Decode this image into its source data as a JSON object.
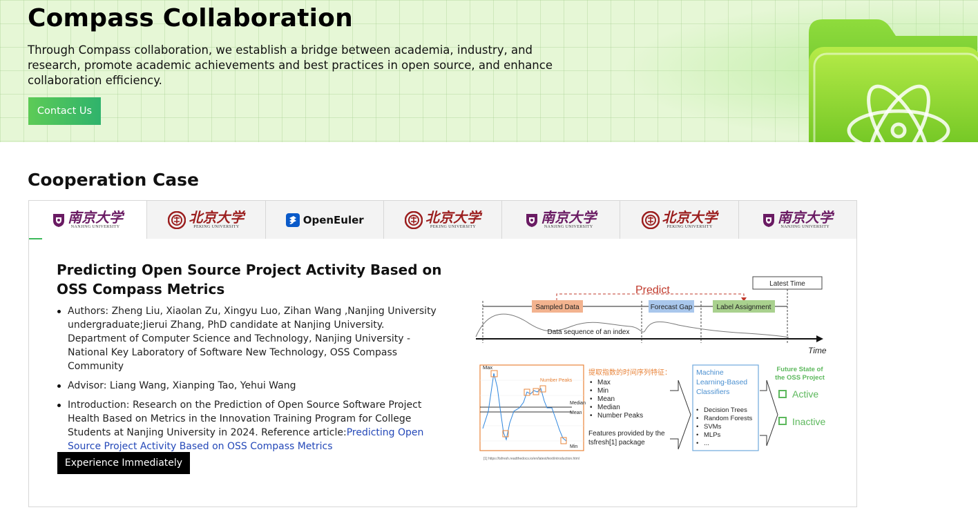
{
  "hero": {
    "title": "Compass Collaboration",
    "description": "Through Compass collaboration, we establish a bridge between academia, industry, and research, promote academic achievements and best practices in open source, and enhance collaboration efficiency.",
    "contact_button": "Contact Us",
    "illustration_icon": "atom-folder-icon"
  },
  "section": {
    "title": "Cooperation Case"
  },
  "tabs": [
    {
      "logo": "nju",
      "cn": "南京大学",
      "en": "NANJING UNIVERSITY",
      "active": true
    },
    {
      "logo": "pku",
      "cn": "北京大学",
      "en": "PEKING UNIVERSITY"
    },
    {
      "logo": "openeuler",
      "name": "OpenEuler"
    },
    {
      "logo": "pku",
      "cn": "北京大学",
      "en": "PEKING UNIVERSITY"
    },
    {
      "logo": "nju",
      "cn": "南京大学",
      "en": "NANJING UNIVERSITY"
    },
    {
      "logo": "pku",
      "cn": "北京大学",
      "en": "PEKING UNIVERSITY"
    },
    {
      "logo": "nju",
      "cn": "南京大学",
      "en": "NANJING UNIVERSITY"
    }
  ],
  "case": {
    "title": "Predicting Open Source Project Activity Based on OSS Compass Metrics",
    "authors": "Authors: Zheng Liu, Xiaolan Zu, Xingyu Luo, Zihan Wang ,Nanjing University undergraduate;Jierui Zhang, PhD candidate at Nanjing University. Department of Computer Science and Technology, Nanjing University - National Key Laboratory of Software New Technology, OSS Compass Community",
    "advisor": "Advisor: Liang Wang, Xianping Tao, Yehui Wang",
    "intro_prefix": "Introduction: Research on the Prediction of Open Source Software Project Health Based on Metrics in the Innovation Training Program for College Students at Nanjing University in 2024. Reference article:",
    "intro_link": "Predicting Open Source Project Activity Based on OSS Compass Metrics",
    "button": "Experience Immediately"
  },
  "diagram": {
    "predict": "Predict",
    "latest_time": "Latest Time",
    "sampled_data": "Sampled Data",
    "forecast_gap": "Forecast Gap",
    "label_assignment": "Label Assignment",
    "data_sequence": "Data sequence of an index",
    "time": "Time",
    "chart_max": "Max",
    "chart_number_peaks": "Number Peaks",
    "chart_median": "Median",
    "chart_mean": "Mean",
    "chart_min": "Min",
    "features_title": "提取指数的时间序列特征：",
    "features": [
      "Max",
      "Min",
      "Mean",
      "Median",
      "Number Peaks"
    ],
    "features_note_1": "Features provided by the",
    "features_note_2": "tsfresh[1] package",
    "classifiers_title_1": "Machine",
    "classifiers_title_2": "Learning-Based",
    "classifiers_title_3": "Classifiers",
    "classifiers": [
      "Decision Trees",
      "Random Forests",
      "SVMs",
      "MLPs",
      "..."
    ],
    "future_title_1": "Future State of",
    "future_title_2": "the OSS Project",
    "active": "Active",
    "inactive": "Inactive",
    "footnote": "[1] https://tsfresh.readthedocs.io/en/latest/text/introduction.html"
  },
  "colors": {
    "accent_green": "#3cb95a",
    "link_blue": "#2448b8",
    "predict_red": "#c0392b",
    "sampled_orange": "#f3b38f",
    "forecast_blue": "#a9c7ec",
    "label_green": "#a9d18e"
  }
}
